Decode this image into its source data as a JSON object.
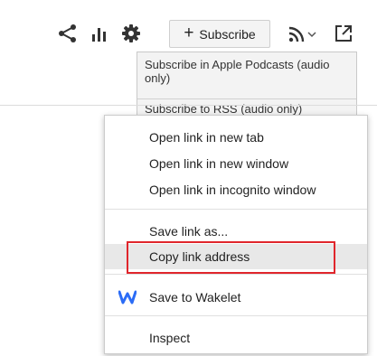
{
  "toolbar": {
    "subscribe_label": "Subscribe",
    "subscribe_plus": "+",
    "icons": [
      "share-icon",
      "stats-icon",
      "gear-icon",
      "rss-icon",
      "chevron-down-icon",
      "external-link-icon"
    ]
  },
  "subscribe_menu": {
    "options": [
      {
        "label": "Subscribe in Apple Podcasts (audio only)"
      },
      {
        "label": "Subscribe to RSS (audio only)"
      }
    ]
  },
  "context_menu": {
    "items": [
      {
        "label": "Open link in new tab"
      },
      {
        "label": "Open link in new window"
      },
      {
        "label": "Open link in incognito window"
      },
      {
        "label": "Save link as..."
      },
      {
        "label": "Copy link address"
      },
      {
        "label": "Save to Wakelet"
      },
      {
        "label": "Inspect"
      }
    ],
    "highlighted_item": "Copy link address",
    "highlight_color": "#e0262c",
    "wakelet_color": "#2b6cf6"
  }
}
